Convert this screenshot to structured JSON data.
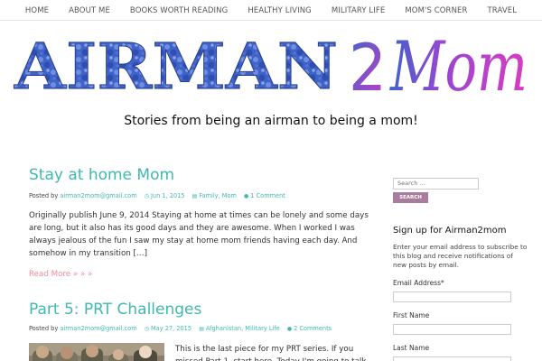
{
  "nav": {
    "items": [
      "HOME",
      "ABOUT ME",
      "BOOKS WORTH READING",
      "HEALTHY LIVING",
      "MILITARY LIFE",
      "MOM'S CORNER",
      "TRAVEL"
    ]
  },
  "header": {
    "logo_text_1": "AIRMAN",
    "logo_text_2": "2",
    "logo_text_3": "Mom",
    "tagline": "Stories from being an airman to being a mom!"
  },
  "posts": [
    {
      "title": "Stay at home Mom",
      "posted_by_label": "Posted by",
      "author": "airman2mom@gmail.com",
      "date": "Jun 1, 2015",
      "categories": "Family, Mom",
      "comments": "1 Comment",
      "excerpt": "Originally publish June 9, 2014 Staying at home at times can be lonely and some days are long, but it also has its good days and they are awesome. When I worked I was always jealous of the fun I saw my stay at home mom friends having each day. And somehow in my transition […]",
      "read_more": "Read More » » »"
    },
    {
      "title": "Part 5: PRT Challenges",
      "posted_by_label": "Posted by",
      "author": "airman2mom@gmail.com",
      "date": "May 27, 2015",
      "categories": "Afghanistan, Military Life",
      "comments": "2 Comments",
      "excerpt": "This is the last piece for my PRT series. If you missed Part 1, start here. Today I'm going to talk"
    }
  ],
  "sidebar": {
    "search_placeholder": "Search …",
    "search_button": "SEARCH",
    "signup_title": "Sign up for Airman2mom",
    "signup_desc": "Enter your email address to subscribe to this blog and receive notifications of new posts by email.",
    "fields": [
      "Email Address*",
      "First Name",
      "Last Name"
    ]
  },
  "colors": {
    "accent_teal": "#3fb9b0",
    "read_more_pink": "#f08a9b",
    "search_button": "#a87c9c",
    "logo_blue": "#3f63c9",
    "logo_pink": "#c93bc8"
  },
  "icons": [
    "clock-icon",
    "folder-icon",
    "comment-icon"
  ]
}
